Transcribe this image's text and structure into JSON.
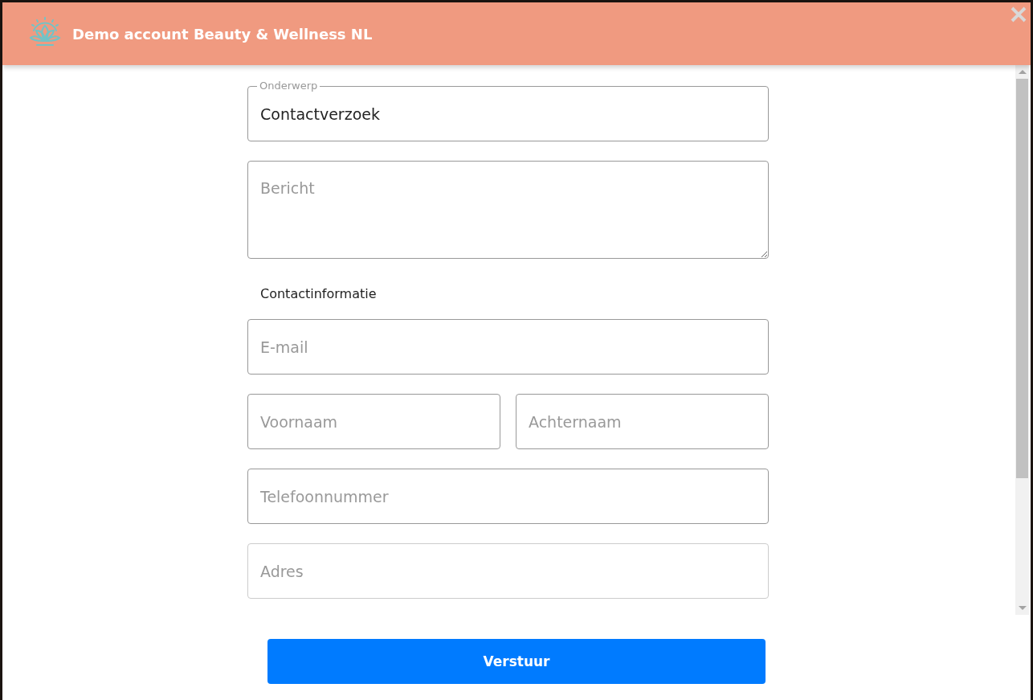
{
  "dialog": {
    "title": "Demo account Beauty & Wellness NL"
  },
  "form": {
    "subject": {
      "label": "Onderwerp",
      "value": "Contactverzoek"
    },
    "message": {
      "placeholder": "Bericht"
    },
    "contact_heading": "Contactinformatie",
    "email": {
      "placeholder": "E-mail"
    },
    "first_name": {
      "placeholder": "Voornaam"
    },
    "last_name": {
      "placeholder": "Achternaam"
    },
    "phone": {
      "placeholder": "Telefoonnummer"
    },
    "address": {
      "placeholder": "Adres"
    }
  },
  "submit_button": {
    "label": "Verstuur"
  }
}
